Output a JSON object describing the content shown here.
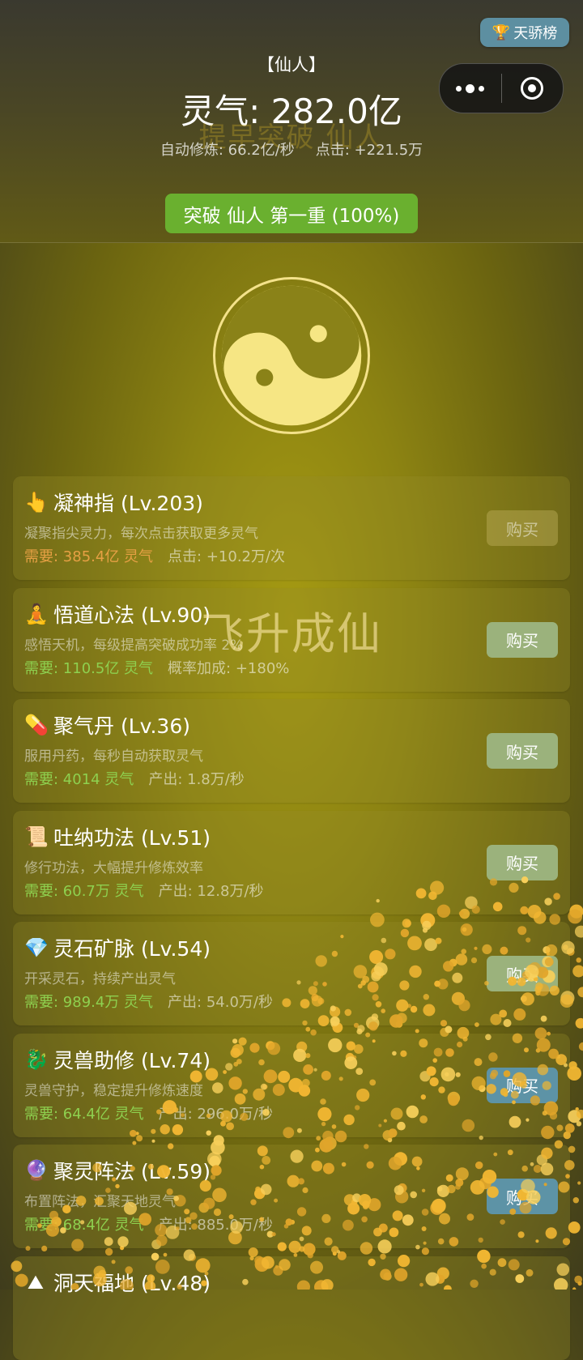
{
  "header": {
    "rank_button": {
      "icon": "trophy-icon",
      "label": "天骄榜"
    },
    "realm": "【仙人】",
    "qi_display": "灵气: 282.0亿",
    "ghost_text": "提早突破 仙人",
    "auto_rate": "自动修炼: 66.2亿/秒",
    "click_rate": "点击: +221.5万",
    "breakthrough_button": "突破 仙人 第一重 (100%)"
  },
  "capsule": {
    "more_icon": "more-dots-icon",
    "close_icon": "target-icon"
  },
  "taiji": {
    "icon": "yin-yang-icon"
  },
  "overlay_title": "飞升成仙",
  "upgrades": [
    {
      "emoji": "👆",
      "icon": "pointing-finger-icon",
      "name": "凝神指 (Lv.203)",
      "desc": "凝聚指尖灵力，每次点击获取更多灵气",
      "cost": "需要: 385.4亿 灵气",
      "effect": "点击: +10.2万/次",
      "buy": "购买",
      "affordable": false
    },
    {
      "emoji": "🧘",
      "icon": "meditation-icon",
      "name": "悟道心法 (Lv.90)",
      "desc": "感悟天机，每级提高突破成功率 2%",
      "cost": "需要: 110.5亿 灵气",
      "effect": "概率加成: +180%",
      "buy": "购买",
      "affordable": true
    },
    {
      "emoji": "💊",
      "icon": "pill-icon",
      "name": "聚气丹 (Lv.36)",
      "desc": "服用丹药，每秒自动获取灵气",
      "cost": "需要: 4014 灵气",
      "effect": "产出: 1.8万/秒",
      "buy": "购买",
      "affordable": true
    },
    {
      "emoji": "📜",
      "icon": "scroll-icon",
      "name": "吐纳功法 (Lv.51)",
      "desc": "修行功法，大幅提升修炼效率",
      "cost": "需要: 60.7万 灵气",
      "effect": "产出: 12.8万/秒",
      "buy": "购买",
      "affordable": true
    },
    {
      "emoji": "💎",
      "icon": "gem-icon",
      "name": "灵石矿脉 (Lv.54)",
      "desc": "开采灵石，持续产出灵气",
      "cost": "需要: 989.4万 灵气",
      "effect": "产出: 54.0万/秒",
      "buy": "购买",
      "affordable": true
    },
    {
      "emoji": "🐉",
      "icon": "dragon-icon",
      "name": "灵兽助修 (Lv.74)",
      "desc": "灵兽守护，稳定提升修炼速度",
      "cost": "需要: 64.4亿 灵气",
      "effect": "产出: 296.0万/秒",
      "buy": "购买",
      "affordable": true
    },
    {
      "emoji": "🔮",
      "icon": "crystal-ball-icon",
      "name": "聚灵阵法 (Lv.59)",
      "desc": "布置阵法，汇聚天地灵气",
      "cost": "需要: 68.4亿 灵气",
      "effect": "产出: 885.0万/秒",
      "buy": "购买",
      "affordable": true
    },
    {
      "emoji": "⛰",
      "icon": "mountain-icon",
      "name": "洞天福地 (Lv.48)",
      "desc": "",
      "cost": "",
      "effect": "",
      "buy": "",
      "affordable": true
    }
  ]
}
